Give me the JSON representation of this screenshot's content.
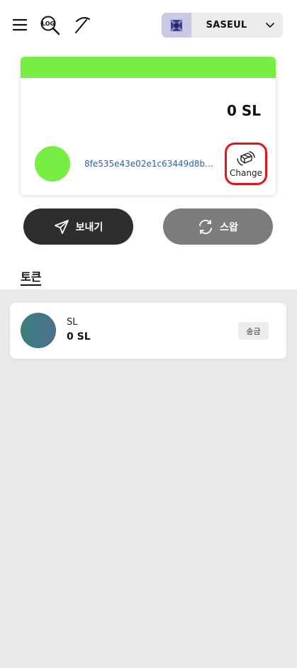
{
  "header": {
    "icons": [
      "menu-icon",
      "log-search-icon",
      "pickaxe-icon"
    ],
    "log_text": "LOG",
    "network": {
      "name": "SASEUL",
      "logo_icon": "network-logo-icon",
      "chevron_icon": "chevron-down-icon"
    }
  },
  "wallet_card": {
    "accent_color": "#77ee44",
    "balance": "0 SL",
    "address": "8fe535e43e02e1c63449d8bbd…",
    "change_label": "Change",
    "change_icon": "wallet-swap-icon"
  },
  "actions": {
    "send_label": "보내기",
    "send_icon": "paper-plane-icon",
    "swap_label": "스왑",
    "swap_icon": "refresh-icon"
  },
  "tokens_section": {
    "title": "토큰",
    "items": [
      {
        "symbol": "SL",
        "balance": "0 SL",
        "action_label": "송금"
      }
    ]
  }
}
